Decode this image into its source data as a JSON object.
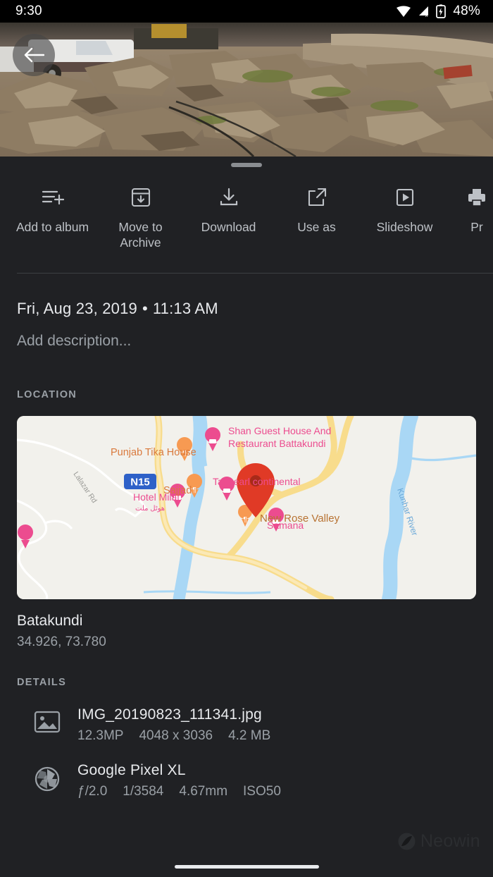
{
  "status_bar": {
    "time": "9:30",
    "battery_percent": "48%",
    "icons": [
      "wifi-icon",
      "cellular-no-signal-icon",
      "battery-charging-icon"
    ]
  },
  "hero": {
    "back_button_label": "Back",
    "photo_alt": "Rocky rubble landscape with white pickup truck"
  },
  "actions": [
    {
      "label": "Add to album",
      "icon": "add-to-album-icon"
    },
    {
      "label": "Move to Archive",
      "icon": "archive-icon"
    },
    {
      "label": "Download",
      "icon": "download-icon"
    },
    {
      "label": "Use as",
      "icon": "open-external-icon"
    },
    {
      "label": "Slideshow",
      "icon": "slideshow-play-icon"
    },
    {
      "label": "Pr",
      "icon": "print-icon"
    }
  ],
  "info": {
    "date": "Fri, Aug 23, 2019",
    "separator": "•",
    "time": "11:13 AM",
    "description_placeholder": "Add description..."
  },
  "location": {
    "section_label": "LOCATION",
    "place_name": "Batakundi",
    "coordinates": "34.926, 73.780",
    "map": {
      "highway_badge": "N15",
      "pin_label": "New Rose Valley",
      "labels": [
        "Shan Guest House And Restaurant Battakundi",
        "Punjab Tika House",
        "Sajjad",
        "Taj pearl continental",
        "Hotel Milat",
        "Samana",
        "New Rose Valley",
        "Kunhar River",
        "Lalazar Rd",
        "ہوٹل ملت"
      ],
      "colors": {
        "land": "#f2f1ec",
        "water": "#a9d7f5",
        "road": "#f8dc8c",
        "poi_text": "#f06292",
        "pin": "#e03a26",
        "highway_badge": "#2e61c8"
      }
    }
  },
  "details": {
    "section_label": "DETAILS",
    "rows": [
      {
        "icon": "image-icon",
        "primary": "IMG_20190823_111341.jpg",
        "secondary": [
          "12.3MP",
          "4048 x 3036",
          "4.2 MB"
        ]
      },
      {
        "icon": "camera-aperture-icon",
        "primary": "Google Pixel XL",
        "secondary": [
          "ƒ/2.0",
          "1/3584",
          "4.67mm",
          "ISO50"
        ]
      }
    ]
  },
  "watermark": {
    "text": "Neowin",
    "icon": "neowin-logo-icon"
  },
  "theme": {
    "background": "#202124",
    "primary_text": "#e8eaed",
    "secondary_text": "#9aa0a6",
    "divider": "#3c4043"
  }
}
